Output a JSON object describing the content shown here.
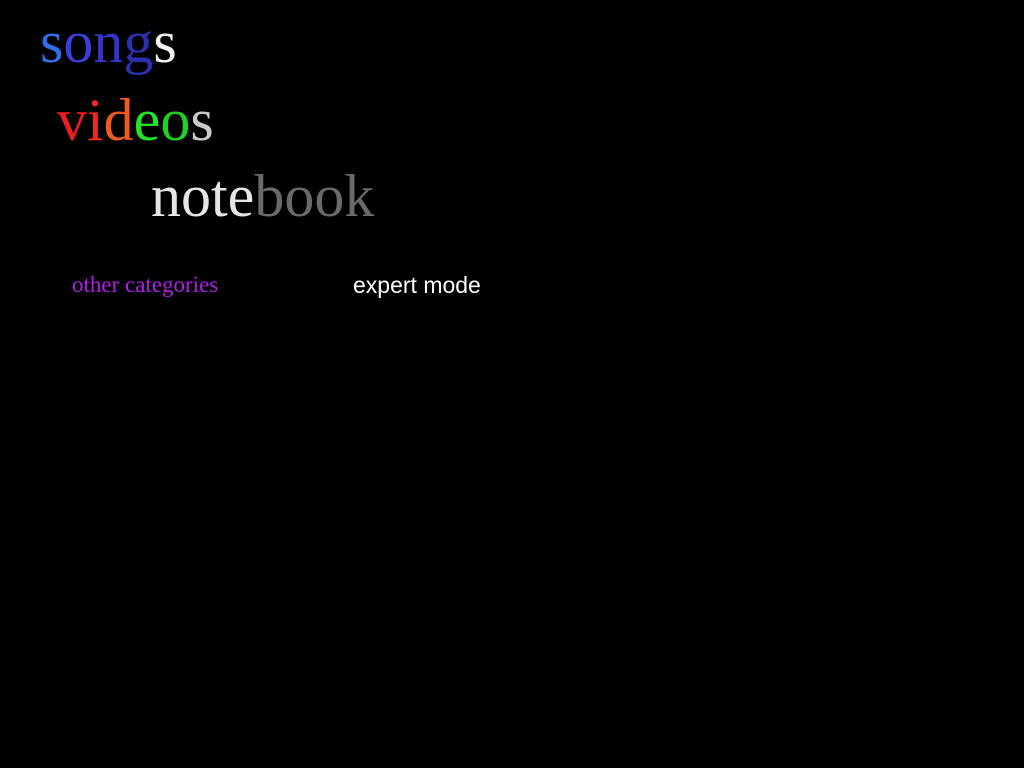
{
  "menu": {
    "songs": {
      "label": "songs",
      "letters": [
        {
          "char": "s",
          "color": "#2f6ee8"
        },
        {
          "char": "o",
          "color": "#3b3fd8"
        },
        {
          "char": "n",
          "color": "#3434c6"
        },
        {
          "char": "g",
          "color": "#2c2fae"
        },
        {
          "char": "s",
          "color": "#f2f2f2"
        }
      ]
    },
    "videos": {
      "label": "videos",
      "letters": [
        {
          "char": "v",
          "color": "#ee1c1c"
        },
        {
          "char": "i",
          "color": "#ef2a22"
        },
        {
          "char": "d",
          "color": "#ef5a1e"
        },
        {
          "char": "e",
          "color": "#22e22a"
        },
        {
          "char": "o",
          "color": "#1fd420"
        },
        {
          "char": "s",
          "color": "#c9c9c9"
        }
      ]
    },
    "notebook": {
      "label": "notebook",
      "letters": [
        {
          "char": "n",
          "color": "#e6e6e6"
        },
        {
          "char": "o",
          "color": "#e6e6e6"
        },
        {
          "char": "t",
          "color": "#e6e6e6"
        },
        {
          "char": "e",
          "color": "#e6e6e6"
        },
        {
          "char": "b",
          "color": "#6a6a6a"
        },
        {
          "char": "o",
          "color": "#6a6a6a"
        },
        {
          "char": "o",
          "color": "#6a6a6a"
        },
        {
          "char": "k",
          "color": "#6a6a6a"
        }
      ]
    }
  },
  "links": {
    "other_categories": {
      "label": "other categories",
      "color": "#b01ee8"
    },
    "expert_mode": {
      "label": "expert mode",
      "color": "#ffffff"
    }
  }
}
